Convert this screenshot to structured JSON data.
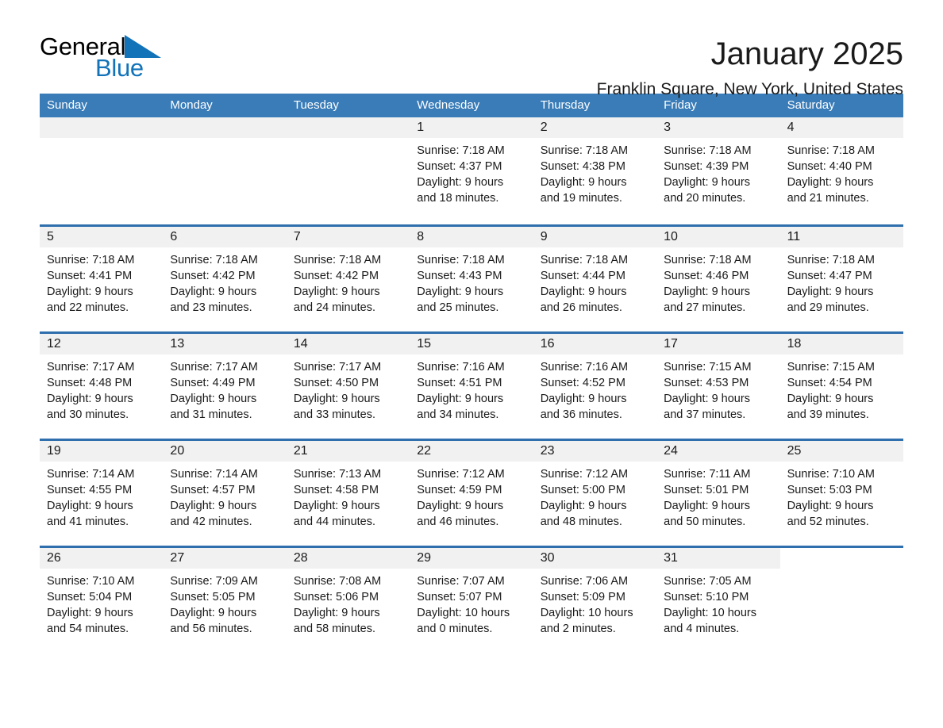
{
  "brand": {
    "name_part1": "General",
    "name_part2": "Blue",
    "mark": "triangle-logo",
    "color_dark": "#000000",
    "color_blue": "#1273b9"
  },
  "header": {
    "title": "January 2025",
    "subtitle": "Franklin Square, New York, United States"
  },
  "theme": {
    "header_bar": "#3a7cb8",
    "row_divider": "#2f6fad",
    "daynum_band": "#f1f1f1",
    "text": "#1a1a1a"
  },
  "weekdays": [
    "Sunday",
    "Monday",
    "Tuesday",
    "Wednesday",
    "Thursday",
    "Friday",
    "Saturday"
  ],
  "weeks": [
    [
      {
        "day": "",
        "sunrise": "",
        "sunset": "",
        "daylight1": "",
        "daylight2": ""
      },
      {
        "day": "",
        "sunrise": "",
        "sunset": "",
        "daylight1": "",
        "daylight2": ""
      },
      {
        "day": "",
        "sunrise": "",
        "sunset": "",
        "daylight1": "",
        "daylight2": ""
      },
      {
        "day": "1",
        "sunrise": "Sunrise: 7:18 AM",
        "sunset": "Sunset: 4:37 PM",
        "daylight1": "Daylight: 9 hours",
        "daylight2": "and 18 minutes."
      },
      {
        "day": "2",
        "sunrise": "Sunrise: 7:18 AM",
        "sunset": "Sunset: 4:38 PM",
        "daylight1": "Daylight: 9 hours",
        "daylight2": "and 19 minutes."
      },
      {
        "day": "3",
        "sunrise": "Sunrise: 7:18 AM",
        "sunset": "Sunset: 4:39 PM",
        "daylight1": "Daylight: 9 hours",
        "daylight2": "and 20 minutes."
      },
      {
        "day": "4",
        "sunrise": "Sunrise: 7:18 AM",
        "sunset": "Sunset: 4:40 PM",
        "daylight1": "Daylight: 9 hours",
        "daylight2": "and 21 minutes."
      }
    ],
    [
      {
        "day": "5",
        "sunrise": "Sunrise: 7:18 AM",
        "sunset": "Sunset: 4:41 PM",
        "daylight1": "Daylight: 9 hours",
        "daylight2": "and 22 minutes."
      },
      {
        "day": "6",
        "sunrise": "Sunrise: 7:18 AM",
        "sunset": "Sunset: 4:42 PM",
        "daylight1": "Daylight: 9 hours",
        "daylight2": "and 23 minutes."
      },
      {
        "day": "7",
        "sunrise": "Sunrise: 7:18 AM",
        "sunset": "Sunset: 4:42 PM",
        "daylight1": "Daylight: 9 hours",
        "daylight2": "and 24 minutes."
      },
      {
        "day": "8",
        "sunrise": "Sunrise: 7:18 AM",
        "sunset": "Sunset: 4:43 PM",
        "daylight1": "Daylight: 9 hours",
        "daylight2": "and 25 minutes."
      },
      {
        "day": "9",
        "sunrise": "Sunrise: 7:18 AM",
        "sunset": "Sunset: 4:44 PM",
        "daylight1": "Daylight: 9 hours",
        "daylight2": "and 26 minutes."
      },
      {
        "day": "10",
        "sunrise": "Sunrise: 7:18 AM",
        "sunset": "Sunset: 4:46 PM",
        "daylight1": "Daylight: 9 hours",
        "daylight2": "and 27 minutes."
      },
      {
        "day": "11",
        "sunrise": "Sunrise: 7:18 AM",
        "sunset": "Sunset: 4:47 PM",
        "daylight1": "Daylight: 9 hours",
        "daylight2": "and 29 minutes."
      }
    ],
    [
      {
        "day": "12",
        "sunrise": "Sunrise: 7:17 AM",
        "sunset": "Sunset: 4:48 PM",
        "daylight1": "Daylight: 9 hours",
        "daylight2": "and 30 minutes."
      },
      {
        "day": "13",
        "sunrise": "Sunrise: 7:17 AM",
        "sunset": "Sunset: 4:49 PM",
        "daylight1": "Daylight: 9 hours",
        "daylight2": "and 31 minutes."
      },
      {
        "day": "14",
        "sunrise": "Sunrise: 7:17 AM",
        "sunset": "Sunset: 4:50 PM",
        "daylight1": "Daylight: 9 hours",
        "daylight2": "and 33 minutes."
      },
      {
        "day": "15",
        "sunrise": "Sunrise: 7:16 AM",
        "sunset": "Sunset: 4:51 PM",
        "daylight1": "Daylight: 9 hours",
        "daylight2": "and 34 minutes."
      },
      {
        "day": "16",
        "sunrise": "Sunrise: 7:16 AM",
        "sunset": "Sunset: 4:52 PM",
        "daylight1": "Daylight: 9 hours",
        "daylight2": "and 36 minutes."
      },
      {
        "day": "17",
        "sunrise": "Sunrise: 7:15 AM",
        "sunset": "Sunset: 4:53 PM",
        "daylight1": "Daylight: 9 hours",
        "daylight2": "and 37 minutes."
      },
      {
        "day": "18",
        "sunrise": "Sunrise: 7:15 AM",
        "sunset": "Sunset: 4:54 PM",
        "daylight1": "Daylight: 9 hours",
        "daylight2": "and 39 minutes."
      }
    ],
    [
      {
        "day": "19",
        "sunrise": "Sunrise: 7:14 AM",
        "sunset": "Sunset: 4:55 PM",
        "daylight1": "Daylight: 9 hours",
        "daylight2": "and 41 minutes."
      },
      {
        "day": "20",
        "sunrise": "Sunrise: 7:14 AM",
        "sunset": "Sunset: 4:57 PM",
        "daylight1": "Daylight: 9 hours",
        "daylight2": "and 42 minutes."
      },
      {
        "day": "21",
        "sunrise": "Sunrise: 7:13 AM",
        "sunset": "Sunset: 4:58 PM",
        "daylight1": "Daylight: 9 hours",
        "daylight2": "and 44 minutes."
      },
      {
        "day": "22",
        "sunrise": "Sunrise: 7:12 AM",
        "sunset": "Sunset: 4:59 PM",
        "daylight1": "Daylight: 9 hours",
        "daylight2": "and 46 minutes."
      },
      {
        "day": "23",
        "sunrise": "Sunrise: 7:12 AM",
        "sunset": "Sunset: 5:00 PM",
        "daylight1": "Daylight: 9 hours",
        "daylight2": "and 48 minutes."
      },
      {
        "day": "24",
        "sunrise": "Sunrise: 7:11 AM",
        "sunset": "Sunset: 5:01 PM",
        "daylight1": "Daylight: 9 hours",
        "daylight2": "and 50 minutes."
      },
      {
        "day": "25",
        "sunrise": "Sunrise: 7:10 AM",
        "sunset": "Sunset: 5:03 PM",
        "daylight1": "Daylight: 9 hours",
        "daylight2": "and 52 minutes."
      }
    ],
    [
      {
        "day": "26",
        "sunrise": "Sunrise: 7:10 AM",
        "sunset": "Sunset: 5:04 PM",
        "daylight1": "Daylight: 9 hours",
        "daylight2": "and 54 minutes."
      },
      {
        "day": "27",
        "sunrise": "Sunrise: 7:09 AM",
        "sunset": "Sunset: 5:05 PM",
        "daylight1": "Daylight: 9 hours",
        "daylight2": "and 56 minutes."
      },
      {
        "day": "28",
        "sunrise": "Sunrise: 7:08 AM",
        "sunset": "Sunset: 5:06 PM",
        "daylight1": "Daylight: 9 hours",
        "daylight2": "and 58 minutes."
      },
      {
        "day": "29",
        "sunrise": "Sunrise: 7:07 AM",
        "sunset": "Sunset: 5:07 PM",
        "daylight1": "Daylight: 10 hours",
        "daylight2": "and 0 minutes."
      },
      {
        "day": "30",
        "sunrise": "Sunrise: 7:06 AM",
        "sunset": "Sunset: 5:09 PM",
        "daylight1": "Daylight: 10 hours",
        "daylight2": "and 2 minutes."
      },
      {
        "day": "31",
        "sunrise": "Sunrise: 7:05 AM",
        "sunset": "Sunset: 5:10 PM",
        "daylight1": "Daylight: 10 hours",
        "daylight2": "and 4 minutes."
      },
      {
        "day": "",
        "sunrise": "",
        "sunset": "",
        "daylight1": "",
        "daylight2": ""
      }
    ]
  ]
}
